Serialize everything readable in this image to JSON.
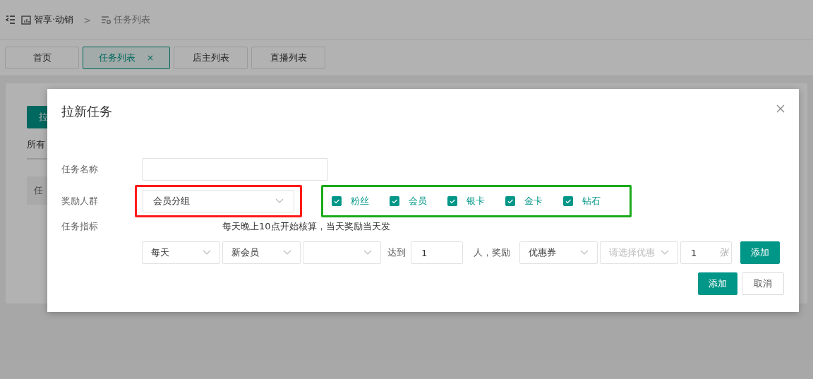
{
  "breadcrumb": [
    {
      "label": "智享·动销"
    },
    {
      "label": "任务列表"
    }
  ],
  "breadcrumb_separator": ">",
  "tabs": [
    {
      "label": "首页",
      "selected": false
    },
    {
      "label": "任务列表",
      "selected": true,
      "close": "×"
    },
    {
      "label": "店主列表",
      "selected": false
    },
    {
      "label": "直播列表",
      "selected": false
    }
  ],
  "background": {
    "button": "拉",
    "filter_tab": "所有",
    "table_header": "任"
  },
  "dialog": {
    "title": "拉新任务",
    "task_name": {
      "label": "任务名称"
    },
    "reward_group": {
      "label": "奖励人群",
      "select": {
        "value": "会员分组"
      },
      "options": [
        {
          "label": "粉丝",
          "checked": true
        },
        {
          "label": "会员",
          "checked": true
        },
        {
          "label": "银卡",
          "checked": true
        },
        {
          "label": "金卡",
          "checked": true
        },
        {
          "label": "钻石",
          "checked": true
        }
      ]
    },
    "indicator": {
      "label": "任务指标",
      "hint": "每天晚上10点开始核算，当天奖励当天发",
      "row": [
        {
          "kind": "select",
          "value": "每天"
        },
        {
          "kind": "select",
          "value": "新会员"
        },
        {
          "kind": "select"
        },
        {
          "kind": "text",
          "text": "达到"
        },
        {
          "kind": "input",
          "value": "1"
        },
        {
          "kind": "text",
          "text": "人，奖励"
        },
        {
          "kind": "select",
          "value": "优惠券"
        },
        {
          "kind": "select",
          "placeholder": "请选择优惠"
        },
        {
          "kind": "input",
          "value": "1",
          "suffix": "张"
        },
        {
          "kind": "button",
          "label": "添加"
        }
      ]
    },
    "buttons": [
      {
        "label": "添加",
        "kind": "primary"
      },
      {
        "label": "取消",
        "kind": "default"
      }
    ]
  }
}
